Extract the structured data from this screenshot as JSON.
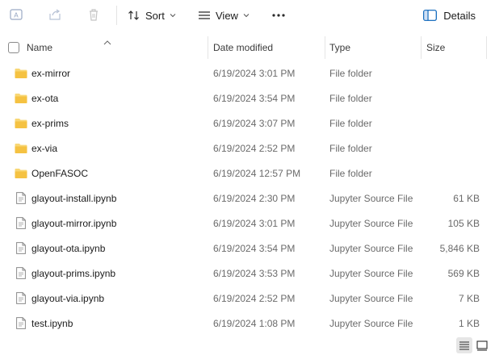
{
  "toolbar": {
    "sort_label": "Sort",
    "view_label": "View",
    "details_label": "Details"
  },
  "columns": {
    "name": "Name",
    "date": "Date modified",
    "type": "Type",
    "size": "Size"
  },
  "files": [
    {
      "name": "ex-mirror",
      "date": "6/19/2024 3:01 PM",
      "type": "File folder",
      "size": "",
      "icon": "folder-icon"
    },
    {
      "name": "ex-ota",
      "date": "6/19/2024 3:54 PM",
      "type": "File folder",
      "size": "",
      "icon": "folder-icon"
    },
    {
      "name": "ex-prims",
      "date": "6/19/2024 3:07 PM",
      "type": "File folder",
      "size": "",
      "icon": "folder-icon"
    },
    {
      "name": "ex-via",
      "date": "6/19/2024 2:52 PM",
      "type": "File folder",
      "size": "",
      "icon": "folder-icon"
    },
    {
      "name": "OpenFASOC",
      "date": "6/19/2024 12:57 PM",
      "type": "File folder",
      "size": "",
      "icon": "folder-icon"
    },
    {
      "name": "glayout-install.ipynb",
      "date": "6/19/2024 2:30 PM",
      "type": "Jupyter Source File",
      "size": "61 KB",
      "icon": "file-icon"
    },
    {
      "name": "glayout-mirror.ipynb",
      "date": "6/19/2024 3:01 PM",
      "type": "Jupyter Source File",
      "size": "105 KB",
      "icon": "file-icon"
    },
    {
      "name": "glayout-ota.ipynb",
      "date": "6/19/2024 3:54 PM",
      "type": "Jupyter Source File",
      "size": "5,846 KB",
      "icon": "file-icon"
    },
    {
      "name": "glayout-prims.ipynb",
      "date": "6/19/2024 3:53 PM",
      "type": "Jupyter Source File",
      "size": "569 KB",
      "icon": "file-icon"
    },
    {
      "name": "glayout-via.ipynb",
      "date": "6/19/2024 2:52 PM",
      "type": "Jupyter Source File",
      "size": "7 KB",
      "icon": "file-icon"
    },
    {
      "name": "test.ipynb",
      "date": "6/19/2024 1:08 PM",
      "type": "Jupyter Source File",
      "size": "1 KB",
      "icon": "file-icon"
    }
  ],
  "colors": {
    "folder": "#f5c242",
    "accent": "#005fb8"
  }
}
